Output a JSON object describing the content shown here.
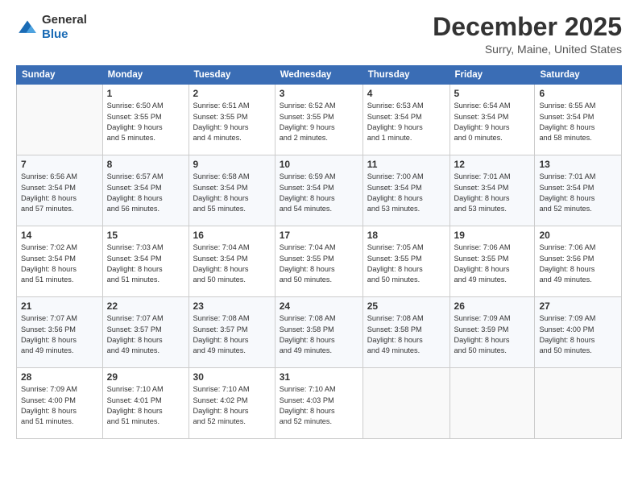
{
  "logo": {
    "text1": "General",
    "text2": "Blue"
  },
  "title": "December 2025",
  "location": "Surry, Maine, United States",
  "days_header": [
    "Sunday",
    "Monday",
    "Tuesday",
    "Wednesday",
    "Thursday",
    "Friday",
    "Saturday"
  ],
  "weeks": [
    [
      {
        "num": "",
        "info": ""
      },
      {
        "num": "1",
        "info": "Sunrise: 6:50 AM\nSunset: 3:55 PM\nDaylight: 9 hours\nand 5 minutes."
      },
      {
        "num": "2",
        "info": "Sunrise: 6:51 AM\nSunset: 3:55 PM\nDaylight: 9 hours\nand 4 minutes."
      },
      {
        "num": "3",
        "info": "Sunrise: 6:52 AM\nSunset: 3:55 PM\nDaylight: 9 hours\nand 2 minutes."
      },
      {
        "num": "4",
        "info": "Sunrise: 6:53 AM\nSunset: 3:54 PM\nDaylight: 9 hours\nand 1 minute."
      },
      {
        "num": "5",
        "info": "Sunrise: 6:54 AM\nSunset: 3:54 PM\nDaylight: 9 hours\nand 0 minutes."
      },
      {
        "num": "6",
        "info": "Sunrise: 6:55 AM\nSunset: 3:54 PM\nDaylight: 8 hours\nand 58 minutes."
      }
    ],
    [
      {
        "num": "7",
        "info": "Sunrise: 6:56 AM\nSunset: 3:54 PM\nDaylight: 8 hours\nand 57 minutes."
      },
      {
        "num": "8",
        "info": "Sunrise: 6:57 AM\nSunset: 3:54 PM\nDaylight: 8 hours\nand 56 minutes."
      },
      {
        "num": "9",
        "info": "Sunrise: 6:58 AM\nSunset: 3:54 PM\nDaylight: 8 hours\nand 55 minutes."
      },
      {
        "num": "10",
        "info": "Sunrise: 6:59 AM\nSunset: 3:54 PM\nDaylight: 8 hours\nand 54 minutes."
      },
      {
        "num": "11",
        "info": "Sunrise: 7:00 AM\nSunset: 3:54 PM\nDaylight: 8 hours\nand 53 minutes."
      },
      {
        "num": "12",
        "info": "Sunrise: 7:01 AM\nSunset: 3:54 PM\nDaylight: 8 hours\nand 53 minutes."
      },
      {
        "num": "13",
        "info": "Sunrise: 7:01 AM\nSunset: 3:54 PM\nDaylight: 8 hours\nand 52 minutes."
      }
    ],
    [
      {
        "num": "14",
        "info": "Sunrise: 7:02 AM\nSunset: 3:54 PM\nDaylight: 8 hours\nand 51 minutes."
      },
      {
        "num": "15",
        "info": "Sunrise: 7:03 AM\nSunset: 3:54 PM\nDaylight: 8 hours\nand 51 minutes."
      },
      {
        "num": "16",
        "info": "Sunrise: 7:04 AM\nSunset: 3:54 PM\nDaylight: 8 hours\nand 50 minutes."
      },
      {
        "num": "17",
        "info": "Sunrise: 7:04 AM\nSunset: 3:55 PM\nDaylight: 8 hours\nand 50 minutes."
      },
      {
        "num": "18",
        "info": "Sunrise: 7:05 AM\nSunset: 3:55 PM\nDaylight: 8 hours\nand 50 minutes."
      },
      {
        "num": "19",
        "info": "Sunrise: 7:06 AM\nSunset: 3:55 PM\nDaylight: 8 hours\nand 49 minutes."
      },
      {
        "num": "20",
        "info": "Sunrise: 7:06 AM\nSunset: 3:56 PM\nDaylight: 8 hours\nand 49 minutes."
      }
    ],
    [
      {
        "num": "21",
        "info": "Sunrise: 7:07 AM\nSunset: 3:56 PM\nDaylight: 8 hours\nand 49 minutes."
      },
      {
        "num": "22",
        "info": "Sunrise: 7:07 AM\nSunset: 3:57 PM\nDaylight: 8 hours\nand 49 minutes."
      },
      {
        "num": "23",
        "info": "Sunrise: 7:08 AM\nSunset: 3:57 PM\nDaylight: 8 hours\nand 49 minutes."
      },
      {
        "num": "24",
        "info": "Sunrise: 7:08 AM\nSunset: 3:58 PM\nDaylight: 8 hours\nand 49 minutes."
      },
      {
        "num": "25",
        "info": "Sunrise: 7:08 AM\nSunset: 3:58 PM\nDaylight: 8 hours\nand 49 minutes."
      },
      {
        "num": "26",
        "info": "Sunrise: 7:09 AM\nSunset: 3:59 PM\nDaylight: 8 hours\nand 50 minutes."
      },
      {
        "num": "27",
        "info": "Sunrise: 7:09 AM\nSunset: 4:00 PM\nDaylight: 8 hours\nand 50 minutes."
      }
    ],
    [
      {
        "num": "28",
        "info": "Sunrise: 7:09 AM\nSunset: 4:00 PM\nDaylight: 8 hours\nand 51 minutes."
      },
      {
        "num": "29",
        "info": "Sunrise: 7:10 AM\nSunset: 4:01 PM\nDaylight: 8 hours\nand 51 minutes."
      },
      {
        "num": "30",
        "info": "Sunrise: 7:10 AM\nSunset: 4:02 PM\nDaylight: 8 hours\nand 52 minutes."
      },
      {
        "num": "31",
        "info": "Sunrise: 7:10 AM\nSunset: 4:03 PM\nDaylight: 8 hours\nand 52 minutes."
      },
      {
        "num": "",
        "info": ""
      },
      {
        "num": "",
        "info": ""
      },
      {
        "num": "",
        "info": ""
      }
    ]
  ]
}
